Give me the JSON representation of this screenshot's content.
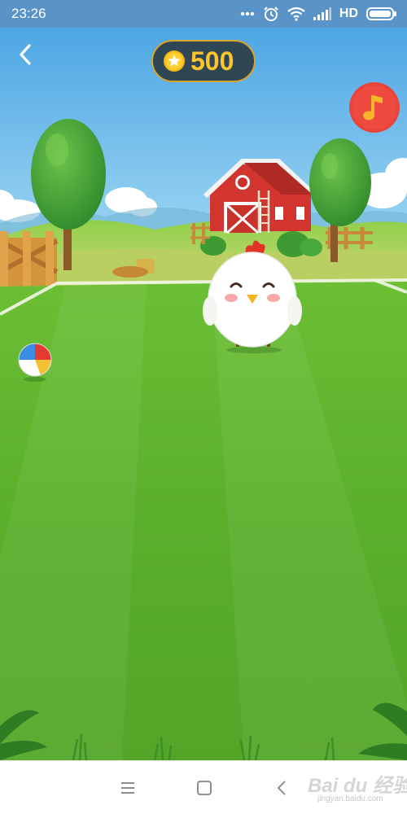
{
  "status_bar": {
    "time": "23:26",
    "network_label": "HD",
    "icons": [
      "more-dots-icon",
      "alarm-icon",
      "wifi-icon",
      "signal-icon",
      "battery-icon"
    ]
  },
  "hud": {
    "back_icon": "chevron-left-icon",
    "coins": "500",
    "coin_icon": "star-coin-icon",
    "music_icon": "music-note-icon"
  },
  "scene": {
    "items": [
      "farm-barn",
      "trees",
      "fences",
      "hay-bales",
      "beach-ball",
      "chick-pet",
      "grass-field"
    ]
  },
  "navbar": {
    "buttons": [
      "menu-icon",
      "home-square-icon",
      "back-triangle-icon"
    ]
  },
  "watermark": {
    "brand": "Bai du 经验",
    "url": "jingyan.baidu.com"
  },
  "colors": {
    "status_bar": "#5a93c8",
    "sky": "#63b5ea",
    "grass": "#5cae2c",
    "coin_text": "#ffc42b",
    "music_button": "#e8443a"
  }
}
